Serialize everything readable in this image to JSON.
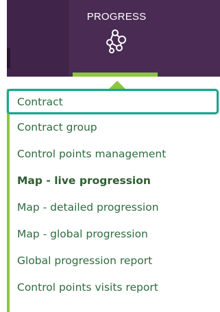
{
  "nav": {
    "active_menu": {
      "title": "PROGRESS",
      "icon": "progress-network-icon"
    }
  },
  "dropdown": {
    "items": [
      {
        "label": "Contract",
        "state": "focused"
      },
      {
        "label": "Contract group"
      },
      {
        "label": "Control points management"
      },
      {
        "label": "Map - live progression",
        "state": "current"
      },
      {
        "label": "Map - detailed progression"
      },
      {
        "label": "Map - global progression"
      },
      {
        "label": "Global progression report"
      },
      {
        "label": "Control points visits report"
      }
    ]
  },
  "colors": {
    "topbar": "#4a2b54",
    "accent": "#8dc63f",
    "focus_ring": "#1aa58b",
    "item_text": "#2e6b3e"
  }
}
